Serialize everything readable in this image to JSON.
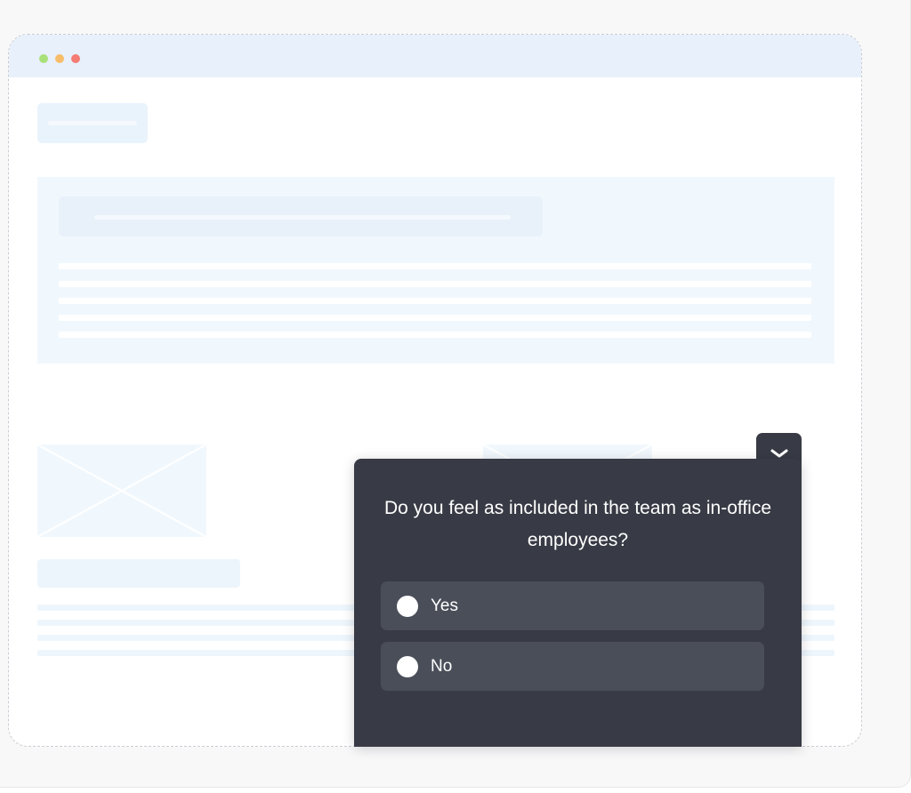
{
  "browser_mock": {
    "window_controls": [
      "green-dot",
      "yellow-dot",
      "red-dot"
    ]
  },
  "survey": {
    "question": "Do you feel as included in the team as in-office employees?",
    "options": [
      {
        "label": "Yes"
      },
      {
        "label": "No"
      }
    ],
    "collapse_icon": "chevron-down-icon"
  },
  "colors": {
    "widget_background": "#383b45",
    "option_background": "#4a4e59",
    "placeholder_blue": "#eef5fc",
    "browser_bar": "#e8f0fb"
  }
}
